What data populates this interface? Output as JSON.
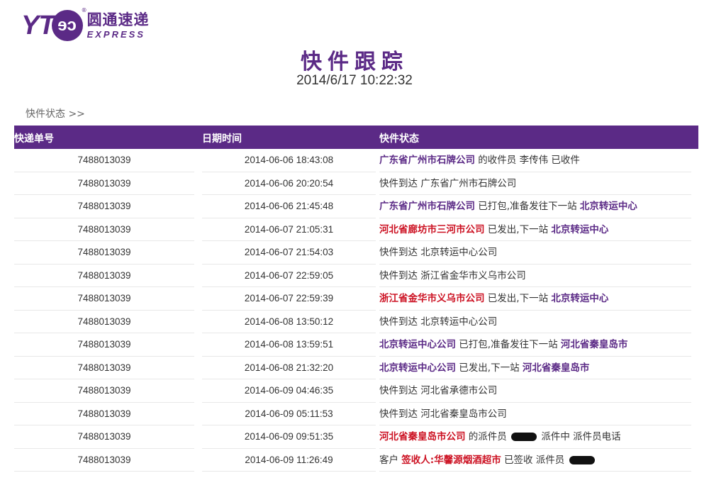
{
  "logo": {
    "yt": "YT",
    "mark": "ɘɔ",
    "registered": "®",
    "cn": "圆通速递",
    "en": "EXPRESS"
  },
  "page": {
    "title": "快件跟踪",
    "datetime": "2014/6/17 10:22:32",
    "breadcrumb": "快件状态 >>"
  },
  "table": {
    "headers": [
      "快递单号",
      "日期时间",
      "快件状态"
    ],
    "rows": [
      {
        "no": "7488013039",
        "time": "2014-06-06 18:43:08",
        "status": [
          {
            "t": "广东省广州市石牌公司",
            "s": "org"
          },
          {
            "t": " 的收件员 李传伟 已收件",
            "s": ""
          }
        ]
      },
      {
        "no": "7488013039",
        "time": "2014-06-06 20:20:54",
        "status": [
          {
            "t": "快件到达 广东省广州市石牌公司",
            "s": ""
          }
        ]
      },
      {
        "no": "7488013039",
        "time": "2014-06-06 21:45:48",
        "status": [
          {
            "t": "广东省广州市石牌公司",
            "s": "org"
          },
          {
            "t": " 已打包,准备发往下一站 ",
            "s": ""
          },
          {
            "t": "北京转运中心",
            "s": "org"
          }
        ]
      },
      {
        "no": "7488013039",
        "time": "2014-06-07 21:05:31",
        "status": [
          {
            "t": "河北省廊坊市三河市公司",
            "s": "red"
          },
          {
            "t": " 已发出,下一站 ",
            "s": ""
          },
          {
            "t": "北京转运中心",
            "s": "org"
          }
        ]
      },
      {
        "no": "7488013039",
        "time": "2014-06-07 21:54:03",
        "status": [
          {
            "t": "快件到达 北京转运中心公司",
            "s": ""
          }
        ]
      },
      {
        "no": "7488013039",
        "time": "2014-06-07 22:59:05",
        "status": [
          {
            "t": "快件到达 浙江省金华市义乌市公司",
            "s": ""
          }
        ]
      },
      {
        "no": "7488013039",
        "time": "2014-06-07 22:59:39",
        "status": [
          {
            "t": "浙江省金华市义乌市公司",
            "s": "red"
          },
          {
            "t": " 已发出,下一站 ",
            "s": ""
          },
          {
            "t": "北京转运中心",
            "s": "org"
          }
        ]
      },
      {
        "no": "7488013039",
        "time": "2014-06-08 13:50:12",
        "status": [
          {
            "t": "快件到达 北京转运中心公司",
            "s": ""
          }
        ]
      },
      {
        "no": "7488013039",
        "time": "2014-06-08 13:59:51",
        "status": [
          {
            "t": "北京转运中心公司",
            "s": "org"
          },
          {
            "t": " 已打包,准备发往下一站 ",
            "s": ""
          },
          {
            "t": "河北省秦皇岛市",
            "s": "org"
          }
        ]
      },
      {
        "no": "7488013039",
        "time": "2014-06-08 21:32:20",
        "status": [
          {
            "t": "北京转运中心公司",
            "s": "org"
          },
          {
            "t": " 已发出,下一站 ",
            "s": ""
          },
          {
            "t": "河北省秦皇岛市",
            "s": "org"
          }
        ]
      },
      {
        "no": "7488013039",
        "time": "2014-06-09 04:46:35",
        "status": [
          {
            "t": "快件到达 河北省承德市公司",
            "s": ""
          }
        ]
      },
      {
        "no": "7488013039",
        "time": "2014-06-09 05:11:53",
        "status": [
          {
            "t": "快件到达 河北省秦皇岛市公司",
            "s": ""
          }
        ]
      },
      {
        "no": "7488013039",
        "time": "2014-06-09 09:51:35",
        "status": [
          {
            "t": "河北省秦皇岛市公司",
            "s": "red"
          },
          {
            "t": " 的派件员 ",
            "s": ""
          },
          {
            "t": "",
            "s": "redact"
          },
          {
            "t": " 派件中 派件员电话",
            "s": ""
          }
        ]
      },
      {
        "no": "7488013039",
        "time": "2014-06-09 11:26:49",
        "status": [
          {
            "t": "客户 ",
            "s": ""
          },
          {
            "t": "签收人:华馨源烟酒超市",
            "s": "red"
          },
          {
            "t": " 已签收 派件员 ",
            "s": ""
          },
          {
            "t": "",
            "s": "redact"
          }
        ]
      }
    ]
  },
  "colors": {
    "brand": "#5b2a86",
    "highlight": "#cc1122"
  }
}
